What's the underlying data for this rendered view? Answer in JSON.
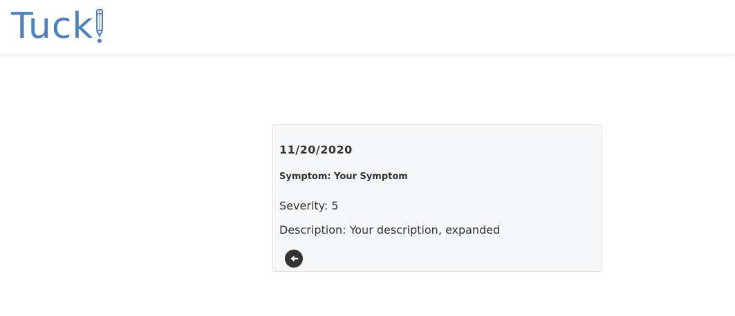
{
  "header": {
    "logo_text": "Tuck",
    "logo_alt": "Tuck!"
  },
  "entry": {
    "date": "11/20/2020",
    "symptom_label": "Symptom:",
    "symptom_value": "Your Symptom",
    "severity_label": "Severity:",
    "severity_value": "5",
    "description_label": "Description:",
    "description_value": "Your description, expanded"
  },
  "icons": {
    "back": "arrow-left-circle-icon",
    "logo_pen": "pen-icon"
  },
  "colors": {
    "brand": "#4a7fc1",
    "card_bg": "#f6f7f9",
    "text": "#333333"
  }
}
